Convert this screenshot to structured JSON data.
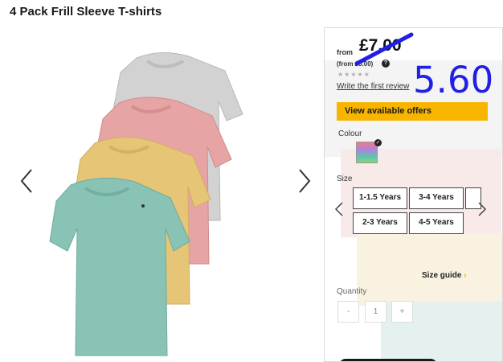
{
  "product": {
    "title": "4 Pack Frill Sleeve T-shirts"
  },
  "panel": {
    "from_label": "from",
    "price": "£7.00",
    "was_text": "(from £8.00)",
    "help": "?",
    "stars": "★★★★★",
    "review_link": "Write the first review",
    "handwritten_price": "5.60",
    "offers_button": "View available offers",
    "colour_label": "Colour",
    "size_label": "Size",
    "sizes": [
      "1-1.5 Years",
      "3-4 Years",
      "",
      "2-3 Years",
      "4-5 Years"
    ],
    "size_guide": "Size guide",
    "size_guide_arrow": "›",
    "quantity_label": "Quantity",
    "qty_minus": "-",
    "qty_value": "1",
    "qty_plus": "+"
  },
  "colors": {
    "accent": "#f8b500",
    "handwriting": "#1f1fe6",
    "shirt_grey": "#cfcfcf",
    "shirt_pink": "#e9a3a3",
    "shirt_yellow": "#e6c575",
    "shirt_teal": "#86c2b5"
  },
  "icons": {
    "gallery_prev": "chevron-left-icon",
    "gallery_next": "chevron-right-icon"
  }
}
